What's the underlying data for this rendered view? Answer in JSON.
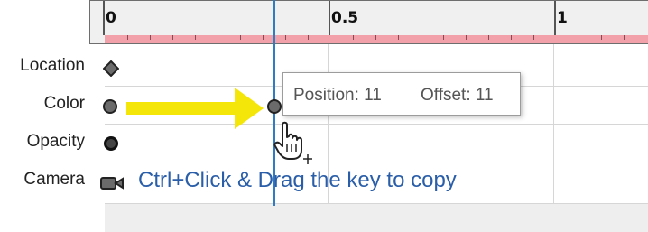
{
  "ruler": {
    "labels": [
      "0",
      "0.5",
      "1"
    ]
  },
  "tracks": [
    {
      "label": "Location",
      "key": "diamond-key-icon"
    },
    {
      "label": "Color",
      "key": "circle-key-icon"
    },
    {
      "label": "Opacity",
      "key": "ring-key-icon"
    },
    {
      "label": "Camera",
      "key": "camera-key-icon"
    }
  ],
  "tooltip": {
    "position": "Position: 11",
    "offset": "Offset: 11"
  },
  "hint": "Ctrl+Click & Drag the key to copy",
  "colors": {
    "ruler_band": "#f2a0aa",
    "playhead": "#2e7cc4",
    "arrow": "#f5e60a",
    "hint_text": "#2a5ea8"
  }
}
